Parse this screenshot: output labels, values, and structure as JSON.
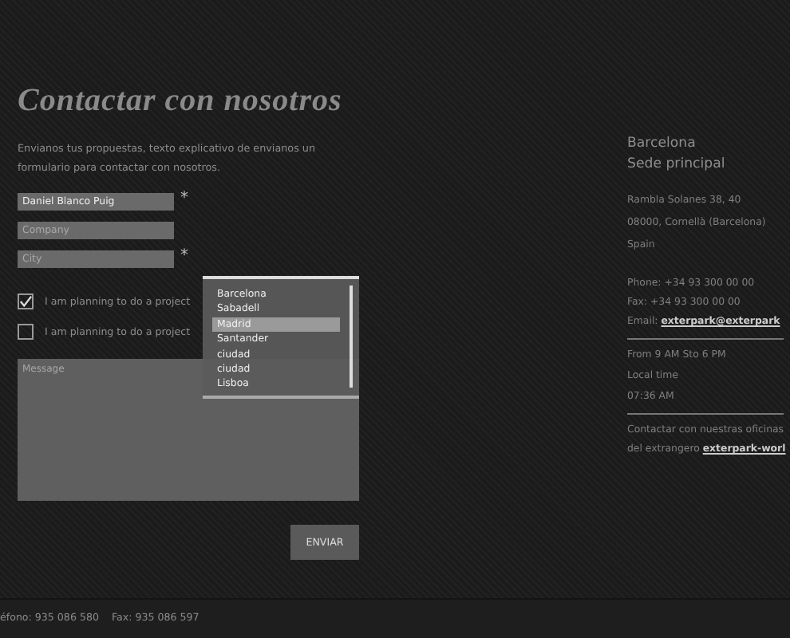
{
  "title": "Contactar con nosotros",
  "intro": "Envianos tus propuestas, texto explicativo de envianos un formulario para contactar con nosotros.",
  "fields": [
    {
      "value": "Daniel Blanco Puig",
      "mark": "*"
    },
    {
      "placeholder": "Company"
    },
    {
      "placeholder": "City",
      "mark": "*"
    }
  ],
  "checkboxes": [
    {
      "label": "I am planning to do a project",
      "checked": true
    },
    {
      "label": "I am planning to do a project",
      "checked": false
    }
  ],
  "city_list": [
    {
      "label": "Barcelona",
      "selected": false
    },
    {
      "label": "Sabadell",
      "selected": false
    },
    {
      "label": "Madrid",
      "selected": true
    },
    {
      "label": "Santander",
      "selected": false
    },
    {
      "label": "ciudad",
      "selected": false
    },
    {
      "label": "ciudad",
      "selected": false
    },
    {
      "label": "Lisboa",
      "selected": false
    }
  ],
  "message": {
    "placeholder": "Message"
  },
  "submit": "ENVIAR",
  "office": {
    "city": "Barcelona",
    "subtitle": "Sede principal",
    "address": [
      "Rambla Solanes 38, 40",
      "08000, Cornellà (Barcelona)",
      "Spain"
    ],
    "phone": "Phone: +34 93 300 00 00",
    "fax": "Fax: +34 93 300 00 00",
    "email_label": "Email:",
    "email": "exterpark@exterpark",
    "hours": [
      "From 9 AM Sto 6 PM",
      "Local time",
      "07:36 AM"
    ],
    "contact_text": "Contactar con nuestras oficinas",
    "contact_text2": "del extrangero",
    "contact_link": "exterpark-worl"
  },
  "footer": [
    "éfono: 935 086 580",
    "Fax: 935 086 597"
  ]
}
